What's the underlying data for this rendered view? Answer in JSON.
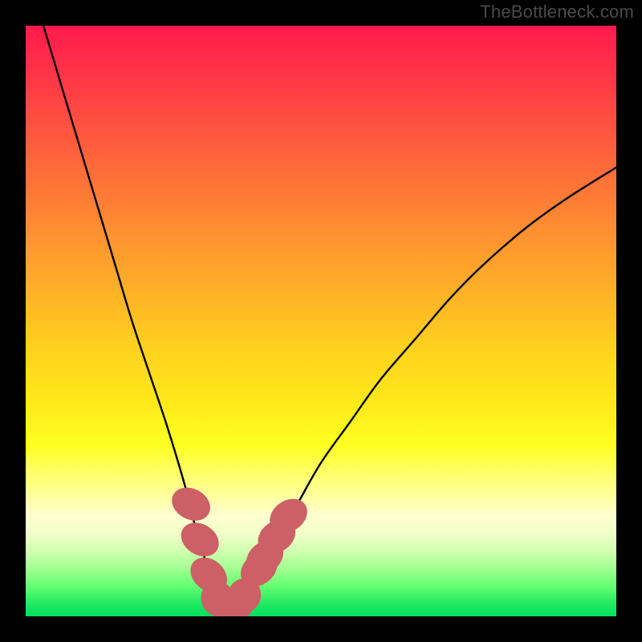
{
  "watermark": "TheBottleneck.com",
  "colors": {
    "frame": "#000000",
    "curve_stroke": "#000000",
    "marker_fill": "#cc6066",
    "marker_stroke": "#cc6066"
  },
  "chart_data": {
    "type": "line",
    "title": "",
    "xlabel": "",
    "ylabel": "",
    "xlim": [
      0,
      100
    ],
    "ylim": [
      0,
      100
    ],
    "series": [
      {
        "name": "bottleneck-curve",
        "x": [
          3,
          6,
          9,
          12,
          15,
          18,
          21,
          24,
          27,
          28.5,
          30,
          31,
          32,
          33,
          34,
          35,
          36,
          37.5,
          39,
          42,
          46,
          50,
          55,
          60,
          66,
          72,
          78,
          85,
          92,
          100
        ],
        "y": [
          100,
          90,
          80,
          70,
          60,
          50,
          41,
          32,
          22,
          16,
          11,
          7,
          4.5,
          2.8,
          2,
          2,
          2.8,
          4.5,
          7,
          12,
          19,
          26,
          33,
          40,
          47,
          54,
          60,
          66,
          71,
          76
        ]
      }
    ],
    "markers": [
      {
        "x": 28.0,
        "y": 19.0,
        "rx": 2.6,
        "ry": 3.4,
        "angle": -62
      },
      {
        "x": 29.5,
        "y": 13.0,
        "rx": 2.6,
        "ry": 3.4,
        "angle": -58
      },
      {
        "x": 31.0,
        "y": 7.0,
        "rx": 2.6,
        "ry": 3.4,
        "angle": -50
      },
      {
        "x": 32.5,
        "y": 3.0,
        "rx": 2.8,
        "ry": 3.0,
        "angle": -20
      },
      {
        "x": 34.0,
        "y": 2.0,
        "rx": 3.0,
        "ry": 2.8,
        "angle": 0
      },
      {
        "x": 35.5,
        "y": 2.0,
        "rx": 3.0,
        "ry": 2.8,
        "angle": 0
      },
      {
        "x": 37.0,
        "y": 3.5,
        "rx": 2.8,
        "ry": 3.0,
        "angle": 25
      },
      {
        "x": 39.5,
        "y": 8.0,
        "rx": 2.6,
        "ry": 3.4,
        "angle": 50
      },
      {
        "x": 40.5,
        "y": 10.0,
        "rx": 2.6,
        "ry": 3.4,
        "angle": 52
      },
      {
        "x": 42.5,
        "y": 13.5,
        "rx": 2.6,
        "ry": 3.4,
        "angle": 55
      },
      {
        "x": 44.5,
        "y": 17.0,
        "rx": 2.6,
        "ry": 3.4,
        "angle": 55
      }
    ],
    "gradient_stops": [
      {
        "pct": 0,
        "color": "#ff1a4d"
      },
      {
        "pct": 24,
        "color": "#ff6a3a"
      },
      {
        "pct": 55,
        "color": "#ffd21e"
      },
      {
        "pct": 78,
        "color": "#ffff88"
      },
      {
        "pct": 92,
        "color": "#a0ff90"
      },
      {
        "pct": 100,
        "color": "#00e060"
      }
    ]
  }
}
